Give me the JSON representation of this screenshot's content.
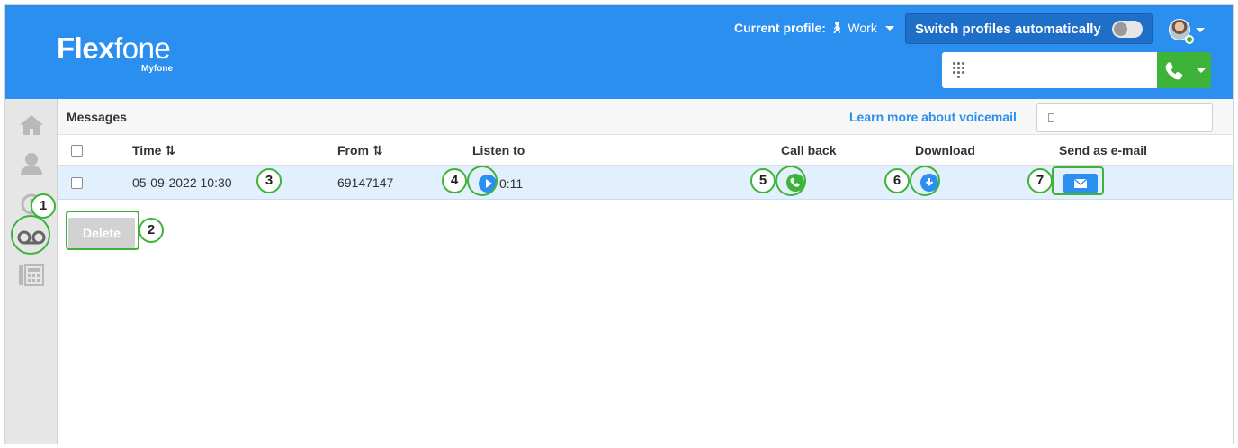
{
  "header": {
    "logo_main": "Flexfone",
    "logo_sub": "Myfone",
    "profile_label": "Current profile:",
    "profile_value": "Work",
    "switch_label": "Switch profiles automatically",
    "switch_on": false
  },
  "messages": {
    "title": "Messages",
    "learn_more": "Learn more about voicemail",
    "search_value": "",
    "columns": {
      "time": "Time",
      "from": "From",
      "listen": "Listen to",
      "call_back": "Call back",
      "download": "Download",
      "send_email": "Send as e-mail"
    },
    "sort_glyph": "⇅",
    "rows": [
      {
        "time": "05-09-2022 10:30",
        "from": "69147147",
        "duration": "0:11"
      }
    ],
    "delete_label": "Delete"
  },
  "annotations": [
    "1",
    "2",
    "3",
    "4",
    "5",
    "6",
    "7"
  ],
  "colors": {
    "header_blue": "#2b8ff0",
    "switch_blue": "#1f6fc9",
    "call_green": "#3db33a",
    "row_highlight": "#e2effc",
    "sidebar_gray": "#e6e6e6",
    "annotation_green": "#3db33a"
  },
  "icons": {
    "sidebar": [
      "home-icon",
      "contact-icon",
      "history-icon",
      "voicemail-icon",
      "phonebook-icon"
    ],
    "keypad": "keypad-icon",
    "call": "phone-icon",
    "play": "play-icon",
    "call_back": "phone-icon",
    "download": "download-icon",
    "email": "envelope-icon"
  }
}
